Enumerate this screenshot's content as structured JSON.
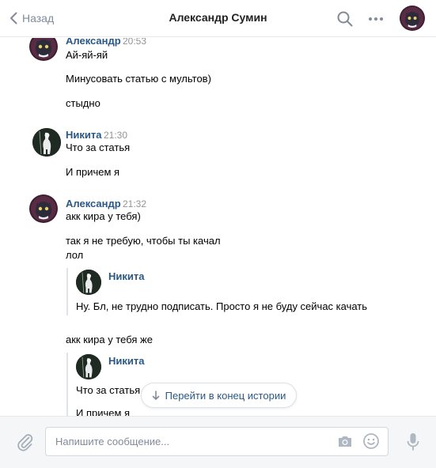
{
  "header": {
    "back_label": "Назад",
    "title": "Александр Сумин"
  },
  "messages": [
    {
      "author": "Александр",
      "time": "20:53",
      "lines": [
        "Ай-яй-яй",
        "Минусовать статью с мультов)",
        "стыдно"
      ]
    },
    {
      "author": "Никита",
      "time": "21:30",
      "lines": [
        "Что за статья",
        "И причем я"
      ]
    },
    {
      "author": "Александр",
      "time": "21:32",
      "lines": [
        "акк кира у тебя)",
        "так я не требую, чтобы ты качал",
        "лол"
      ],
      "forwarded_1": {
        "author": "Никита",
        "text": "Ну. Бл, не трудно подписать. Просто я не буду сейчас качать"
      },
      "line_after": "акк кира у тебя же",
      "forwarded_2": {
        "author": "Никита",
        "text_1": "Что за статья",
        "text_2": "И причем я"
      }
    }
  ],
  "jump_button": {
    "label": "Перейти в конец истории",
    "icon": "arrow-down-icon"
  },
  "composer": {
    "placeholder": "Напишите сообщение...",
    "value": ""
  },
  "icons": {
    "back": "chevron-left-icon",
    "search": "search-icon",
    "more": "more-dots-icon",
    "attach": "paperclip-icon",
    "camera": "camera-icon",
    "emoji": "smile-icon",
    "mic": "microphone-icon"
  },
  "colors": {
    "link": "#2a5885",
    "muted": "#828a99",
    "time": "#939393",
    "composer_bg": "#f5f6f8"
  }
}
